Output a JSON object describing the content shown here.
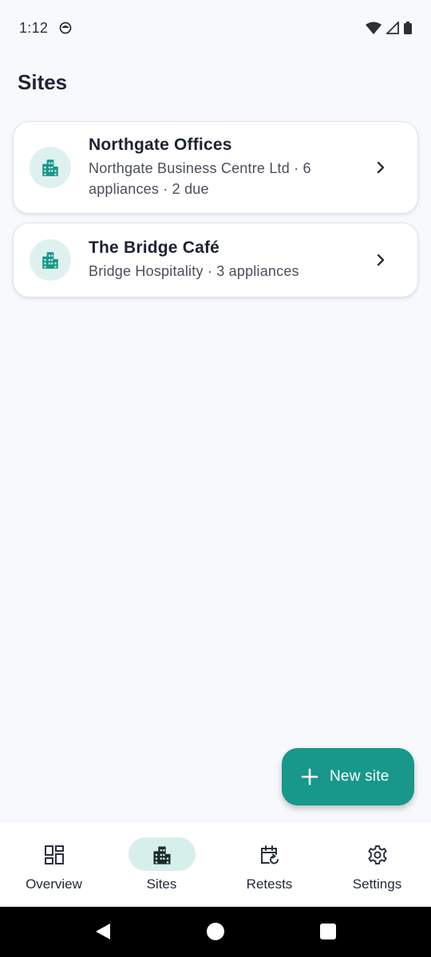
{
  "status_bar": {
    "time": "1:12"
  },
  "page": {
    "title": "Sites"
  },
  "sites": [
    {
      "name": "Northgate Offices",
      "subtitle": "Northgate Business Centre Ltd · 6 appliances · 2 due",
      "icon": "building-icon"
    },
    {
      "name": "The Bridge Café",
      "subtitle": "Bridge Hospitality · 3 appliances",
      "icon": "building-icon"
    }
  ],
  "fab": {
    "label": "New site",
    "icon": "plus-icon"
  },
  "bottom_nav": {
    "items": [
      {
        "label": "Overview",
        "icon": "dashboard-icon"
      },
      {
        "label": "Sites",
        "icon": "building-icon",
        "selected": true
      },
      {
        "label": "Retests",
        "icon": "calendar-refresh-icon"
      },
      {
        "label": "Settings",
        "icon": "gear-icon"
      }
    ]
  },
  "colors": {
    "accent": "#17988a",
    "accent_light": "#dff1ee",
    "background": "#f7f9fc"
  }
}
